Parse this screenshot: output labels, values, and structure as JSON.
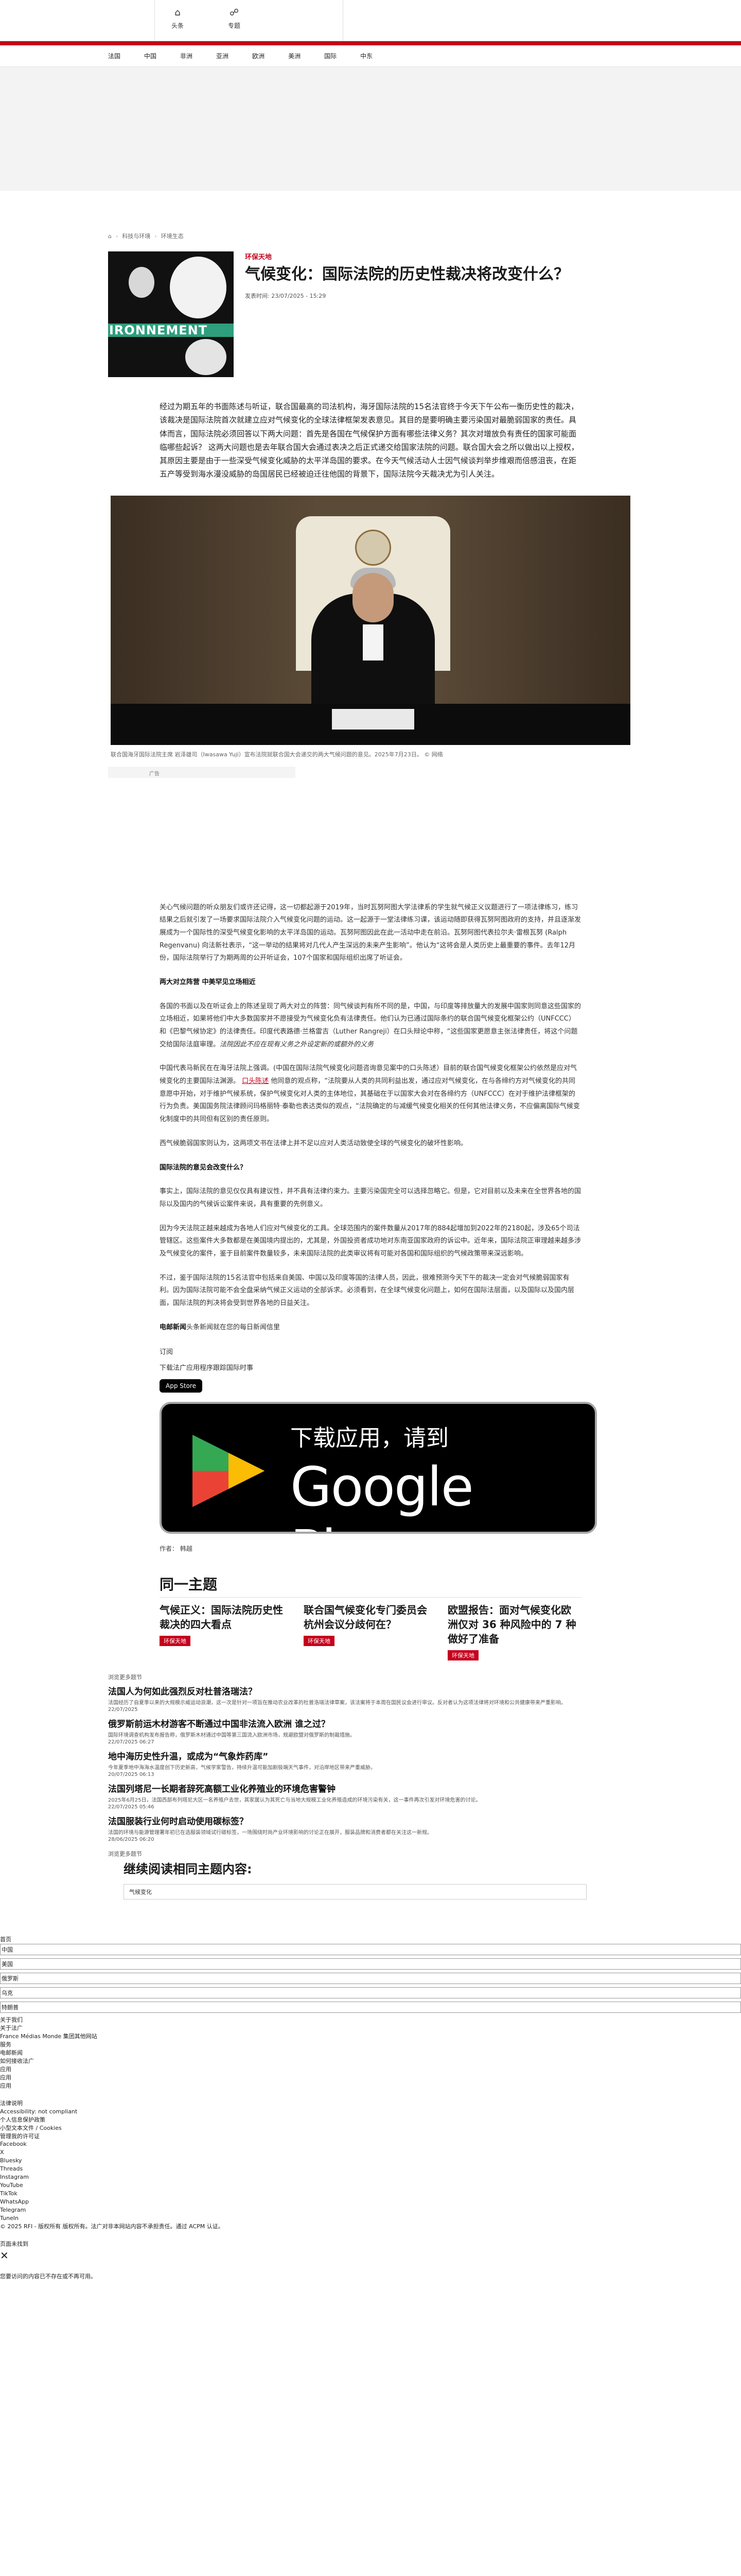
{
  "topnav": {
    "home_label": "头条",
    "topics_label": "专题"
  },
  "menu": [
    "法国",
    "中国",
    "非洲",
    "亚洲",
    "欧洲",
    "美洲",
    "国际",
    "中东"
  ],
  "breadcrumb": [
    "首页",
    "科技与环境",
    "环境生态"
  ],
  "article": {
    "kicker": "环保天地",
    "title": "气候变化：国际法院的历史性裁决将改变什么？",
    "pubdate": "发表时间: 23/07/2025 - 15:29",
    "thumb_word": "IRONNEMENT",
    "lead": "经过为期五年的书面陈述与听证，联合国最高的司法机构，海牙国际法院的15名法官终于今天下午公布一衡历史性的裁决，该裁决是国际法院首次就建立应对气候变化的全球法律框架发表意见。其目的是要明确主要污染国对最脆弱国家的责任。具体而言，国际法院必须回答以下两大问题：首先是各国在气候保护方面有哪些法律义务？其次对增放负有责任的国家可能面临哪些起诉？ 这两大问题也是去年联合国大会通过表决之后正式递交给国家法院的问题。联合国大会之所以做出以上授权，其原因主要是由于一些深受气候变化威胁的太平洋岛国的要求。在今天气候活动人士因气候谈判举步维艰而倍感沮丧，在距五产等受到海水漫没威胁的岛国居民已经被迫迁往他国的背景下，国际法院今天裁决尤为引人关注。",
    "photo_caption": "联合国海牙国际法院主席 岩泽雄司（Iwasawa Yuji）宣布法院就联合国大会递交的两大气候问题的意见。2025年7月23日。 © 网络",
    "ad_label": "广告"
  },
  "body": {
    "p1": "关心气候问题的听众朋友们或许还记得，这一切都起源于2019年，当时瓦努阿图大学法律系的学生就气候正义议题进行了一项法律练习，练习结果之后就引发了一场要求国际法院介入气候变化问题的运动。这一起源于一堂法律练习课，该运动随即获得瓦努阿图政府的支持，并且逐渐发展成为一个国际性的深受气候变化影响的太平洋岛国的运动。瓦努阿图因此在此一活动中走在前沿。瓦努阿图代表拉尔夫·雷根瓦努 (Ralph Regenvanu) 向法新社表示，“这一举动的结果将对几代人产生深远的未来产生影响”。他认为“这将会是人类历史上最重要的事件。去年12月份，国际法院举行了为期两周的公开听证会，107个国家和国际组织出席了听证会。",
    "h1": "两大对立阵营 中美罕见立场相近",
    "p2": "各国的书面以及在听证会上的陈述呈现了两大对立的阵营：同气候谈判有所不同的是，中国，与印度等排放量大的发展中国家则同意这些国家的立场相近，如果将他们中大多数国家并不愿接受为气候变化负有法律责任。他们认为已通过国际条约的联合国气候变化框架公约（UNFCCC）和《巴黎气候协定》的法律责任。印度代表路德·兰格雷吉（Luther Rangreji）在口头辩论中称，“这些国家更愿意主张法律责任，将这个问题交给国际法庭审理。",
    "p2_em": "法院因此不应在现有义务之外设定新的或额外的义务",
    "p3a": "中国代表马新民在在海牙法院上强调。(中国在国际法院气候变化问题咨询意见案中的口头陈述）目前的联合国气候变化框架公约依然是应对气候变化的主要国际法渊源。",
    "p3_link": "口头陈述",
    "p3b": "他同意的观点称，“法院要从人类的共同利益出发，通过应对气候变化，在与各缔约方对气候变化的共同意愿中开始，对于维护气候系统，保护气候变化对人类的主体地位，其基础在于以国家大会对在各缔约方（UNFCCC）在对于维护法律框架的行为负责。美国国务院法律顾问玛格丽特·泰勒也表达类似的观点，“法院确定的与减缓气候变化相关的任何其他法律义务，不应偏离国际气候变化制度中的共同但有区别的责任原则。",
    "p4": "西气候脆弱国家则认为，这两项文书在法律上并不足以应对人类活动致使全球的气候变化的破坏性影响。",
    "h2": "国际法院的意见会改变什么？",
    "p5": "事实上，国际法院的意见仅仅具有建议性，并不具有法律约束力。主要污染国完全可以选择忽略它。但是，它对目前以及未来在全世界各地的国际以及国内的气候诉讼案件来说，具有重要的先例意义。",
    "p6": "因为今天法院正越来越成为各地人们应对气候变化的工具。全球范围内的案件数量从2017年的884起增加到2022年的2180起，涉及65个司法管辖区。这些案件大多数都是在美国境内提出的，尤其是，外国投资者成功地对东南亚国家政府的诉讼中。近年来，国际法院正审理越来越多涉及气候变化的案件，鉴于目前案件数量较多，未来国际法院的此类审议将有可能对各国和国际组织的气候政策带来深远影响。",
    "p7": "不过，鉴于国际法院的15名法官中包括来自美国、中国以及印度等国的法律人员，因此，很难预测今天下午的裁决一定会对气候脆弱国家有利。因为国际法院可能不会全盘采纳气候正义运动的全部诉求。必须看到，在全球气候变化问题上，如何在国际法层面，以及国际以及国内层面，国际法院的判决将会受到世界各地的日益关注。",
    "p8_bold": "电邮新闻",
    "p8": "头条新闻就在您的每日新闻信里"
  },
  "subscribe": {
    "label": "订阅",
    "download": "下载法广应用程序跟踪国际时事",
    "appstore": "App Store",
    "gp_line1": "下载应用，请到",
    "gp_line2": "Google Play",
    "author": "作者： 韩越"
  },
  "related": {
    "heading": "同一主题",
    "cards": [
      {
        "title": "气候正义：国际法院历史性裁决的四大看点",
        "tag": "环保天地"
      },
      {
        "title": "联合国气候变化专门委员会杭州会议分歧何在？",
        "tag": "环保天地"
      },
      {
        "title": "欧盟报告：面对气候变化欧洲仅对 36 种风险中的 7 种做好了准备",
        "tag": "环保天地"
      }
    ]
  },
  "feed": {
    "label": "浏览更多题节",
    "items": [
      {
        "title": "法国人为何如此强烈反对杜普洛瑞法？",
        "desc": "法国经历了自夏季以来的大规模示威运动浪潮，这一次是针对一项旨在推动农业改革的杜普洛瑞法律草案，该法案将于本周在国民议会进行审议。反对者认为这项法律将对环境和公共健康带来严重影响。",
        "ts": "22/07/2025"
      },
      {
        "title": "俄罗斯前运木材游客不断通过中国非法流入欧洲 谁之过？",
        "desc": "国际环境调查机构发布报告称，俄罗斯木材通过中国等第三国流入欧洲市场，规避欧盟对俄罗斯的制裁措施。",
        "ts": "22/07/2025 06:27"
      },
      {
        "title": "地中海历史性升温，或成为“气象炸药库”",
        "desc": "今年夏季地中海海水温度创下历史新高，气候学家警告，持续升温可能加剧极端天气事件，对沿岸地区带来严重威胁。",
        "ts": "20/07/2025 06:13"
      },
      {
        "title": "法国列塔尼一长期者辞死高额工业化养殖业的环境危害警钟",
        "desc": "2025年6月25日，法国西部布列塔尼大区一名养殖户去世，其家属认为其死亡与当地大规模工业化养殖造成的环境污染有关，这一事件再次引发对环境危害的讨论。",
        "ts": "22/07/2025 05:46"
      },
      {
        "title": "法国服装行业何时启动使用碳标签？",
        "desc": "法国的环境与能源管理署年初已在选服装领域试行碳标签，一场围绕时尚产业环境影响的讨论正在展开，服装品牌和消费者都在关注这一新规。",
        "ts": "28/06/2025 06:20"
      }
    ]
  },
  "continue": {
    "label": "浏览更多题节",
    "heading": "继续阅读相同主题内容:",
    "chip": "气候变化"
  },
  "footer": {
    "top_lines": [
      "首页"
    ],
    "boxed": [
      "中国",
      "美国",
      "俄罗斯",
      "乌克",
      "特朗普"
    ],
    "lines": [
      "关于我们",
      "关于法广",
      "France Médias Monde 集团其他网站",
      "服务",
      "电邮新闻",
      "如何接收法广",
      "应用",
      "应用",
      "应用",
      "法律说明",
      "Accessibility: not compliant",
      "个人信息保护政策",
      "小型文本文件 / Cookies",
      "管理我的许可证",
      "Facebook",
      "X",
      "Bluesky",
      "Threads",
      "Instagram",
      "YouTube",
      "TikTok",
      "WhatsApp",
      "Telegram",
      "TuneIn",
      "© 2025 RFI - 版权所有 版权所有。法广对非本网站内容不承担责任。通过 ACPM 认证。",
      "页面未找到"
    ],
    "closing": "您要访问的内容已不存在或不再可用。"
  }
}
